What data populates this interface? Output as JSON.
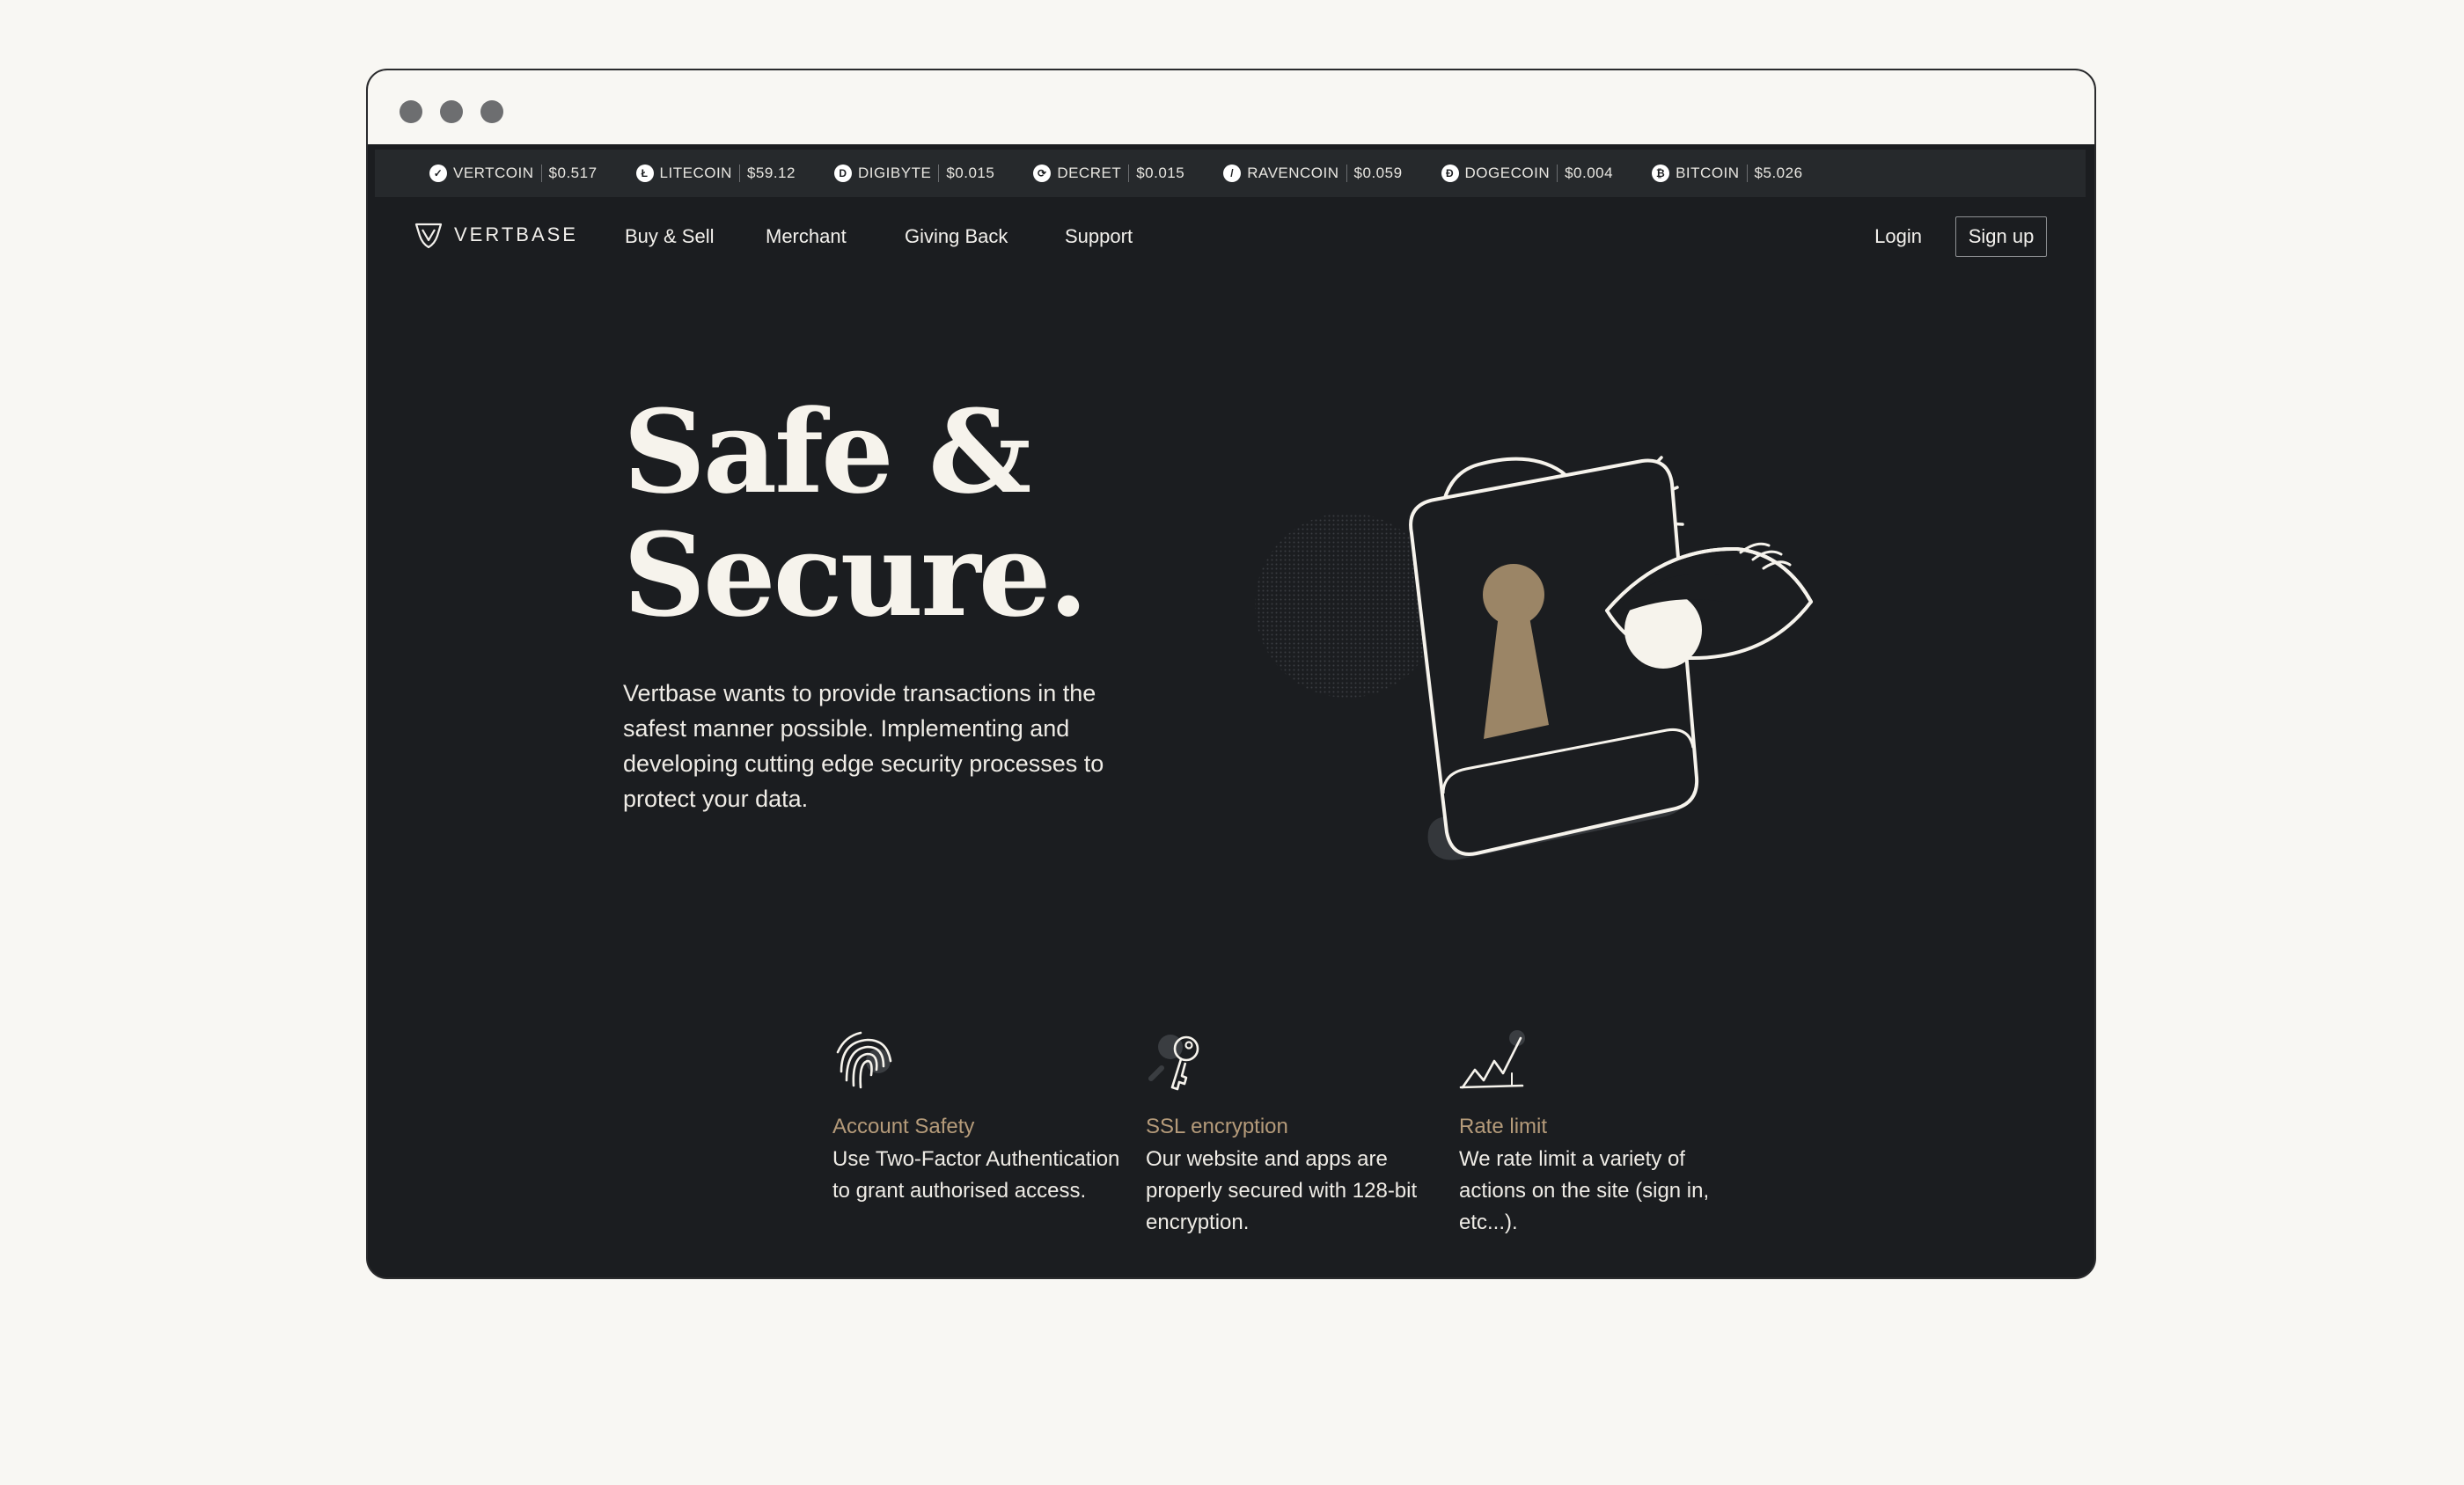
{
  "colors": {
    "page_background": "#f8f7f3",
    "app_background": "#1b1d20",
    "ticker_background": "#26292c",
    "accent": "#b59b7a",
    "text": "#f2f0ec"
  },
  "ticker": [
    {
      "name": "VERTCOIN",
      "price": "$0.517",
      "icon": "vertcoin-icon",
      "glyph": "✓"
    },
    {
      "name": "LITECOIN",
      "price": "$59.12",
      "icon": "litecoin-icon",
      "glyph": "Ł"
    },
    {
      "name": "DIGIBYTE",
      "price": "$0.015",
      "icon": "digibyte-icon",
      "glyph": "D"
    },
    {
      "name": "DECRET",
      "price": "$0.015",
      "icon": "decred-icon",
      "glyph": "⟳"
    },
    {
      "name": "RAVENCOIN",
      "price": "$0.059",
      "icon": "ravencoin-icon",
      "glyph": "/"
    },
    {
      "name": "DOGECOIN",
      "price": "$0.004",
      "icon": "dogecoin-icon",
      "glyph": "Ð"
    },
    {
      "name": "BITCOIN",
      "price": "$5.026",
      "icon": "bitcoin-icon",
      "glyph": "₿"
    }
  ],
  "nav": {
    "brand": "VERTBASE",
    "links": [
      "Buy & Sell",
      "Merchant",
      "Giving Back",
      "Support"
    ],
    "login": "Login",
    "signup": "Sign up"
  },
  "hero": {
    "title_line1": "Safe &",
    "title_line2": "Secure.",
    "description": "Vertbase wants to provide transactions in the safest manner possible. Implementing and developing cutting edge security processes to protect your data.",
    "illustration": "padlock-with-eye-illustration"
  },
  "features": [
    {
      "icon": "fingerprint-icon",
      "title": "Account Safety",
      "text": "Use Two-Factor Authentication to grant authorised access."
    },
    {
      "icon": "key-icon",
      "title": "SSL encryption",
      "text": "Our website and apps are properly secured with 128-bit encryption."
    },
    {
      "icon": "chart-line-icon",
      "title": "Rate limit",
      "text": "We rate limit a variety of actions on the site (sign in, etc...)."
    }
  ]
}
